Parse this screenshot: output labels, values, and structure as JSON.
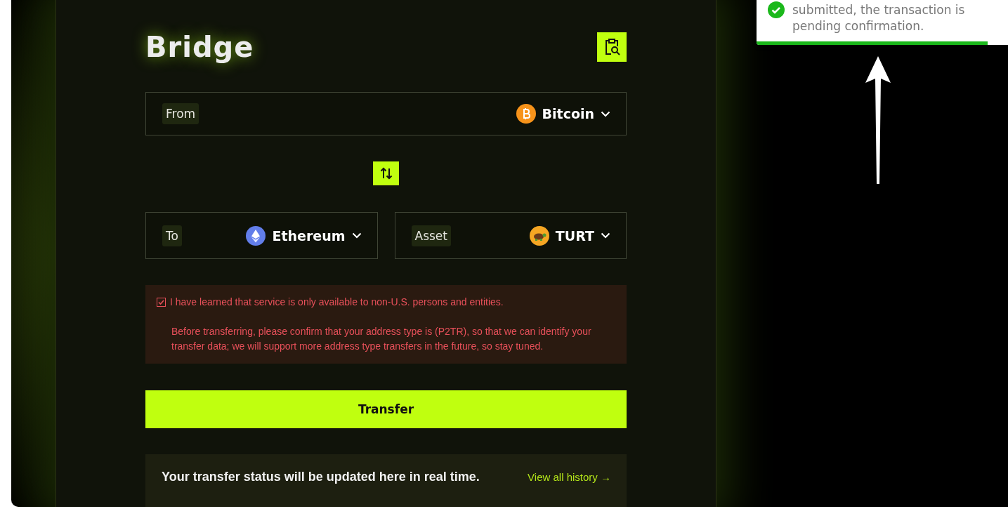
{
  "header": {
    "title": "Bridge"
  },
  "from": {
    "label": "From",
    "value": "Bitcoin",
    "kind": "bitcoin"
  },
  "to": {
    "label": "To",
    "value": "Ethereum",
    "kind": "ethereum"
  },
  "asset": {
    "label": "Asset",
    "value": "TURT",
    "kind": "turtle"
  },
  "notice": {
    "checked": true,
    "agreement": "I have learned that service is only available to non-U.S. persons and entities.",
    "detail": "Before transferring, please confirm that your address type is (P2TR), so that we can identify your transfer data; we will support more address type transfers in the future, so stay tuned."
  },
  "transfer_button": "Transfer",
  "status": {
    "message": "Your transfer status will be updated here in real time.",
    "link": "View all history →"
  },
  "toast": {
    "message": "submitted, the transaction is pending confirmation.",
    "level": 0.92
  }
}
